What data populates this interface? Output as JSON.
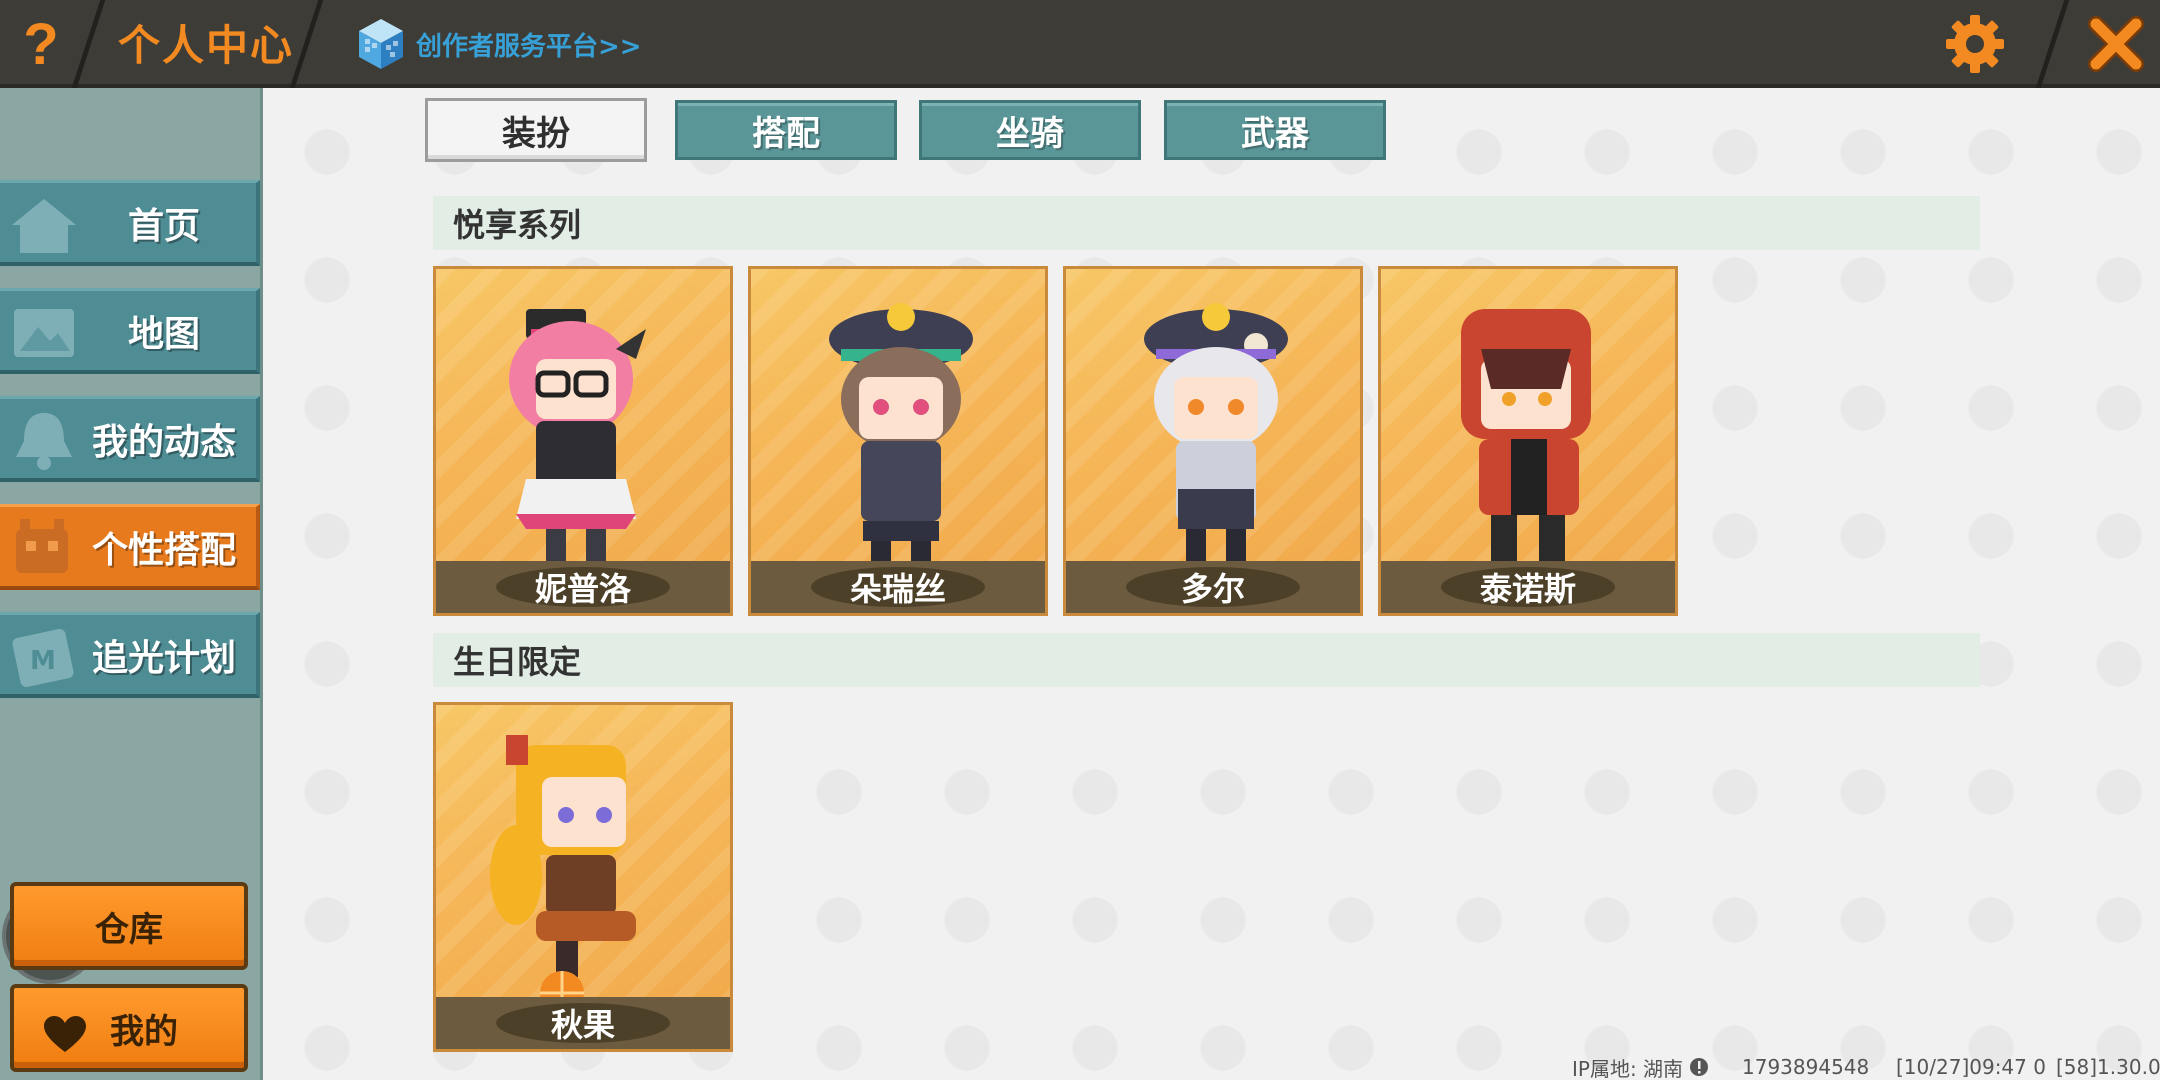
{
  "topbar": {
    "help_label": "?",
    "title": "个人中心",
    "creator_link": "创作者服务平台>>"
  },
  "sidebar": {
    "items": [
      {
        "label": "首页",
        "icon": "house-icon"
      },
      {
        "label": "地图",
        "icon": "map-icon"
      },
      {
        "label": "我的动态",
        "icon": "bell-icon"
      },
      {
        "label": "个性搭配",
        "icon": "character-icon",
        "active": true
      },
      {
        "label": "追光计划",
        "icon": "plan-icon"
      }
    ],
    "warehouse_label": "仓库",
    "mine_label": "我的"
  },
  "tabs": [
    {
      "label": "装扮",
      "active": true
    },
    {
      "label": "搭配"
    },
    {
      "label": "坐骑"
    },
    {
      "label": "武器"
    }
  ],
  "sections": [
    {
      "title": "悦享系列",
      "cards": [
        {
          "name": "妮普洛"
        },
        {
          "name": "朵瑞丝"
        },
        {
          "name": "多尔"
        },
        {
          "name": "泰诺斯"
        }
      ]
    },
    {
      "title": "生日限定",
      "cards": [
        {
          "name": "秋果"
        }
      ]
    }
  ],
  "footer": {
    "ip_location": "IP属地: 湖南",
    "uid": "1793894548",
    "timestamp": "[10/27]09:47 0",
    "version": "[58]1.30.0"
  },
  "colors": {
    "accent_orange": "#f28a21",
    "topbar_bg": "#3d3c37",
    "nav_teal": "#4f8d95",
    "tab_teal": "#5a9597",
    "creator_link_blue": "#37a0d7"
  }
}
